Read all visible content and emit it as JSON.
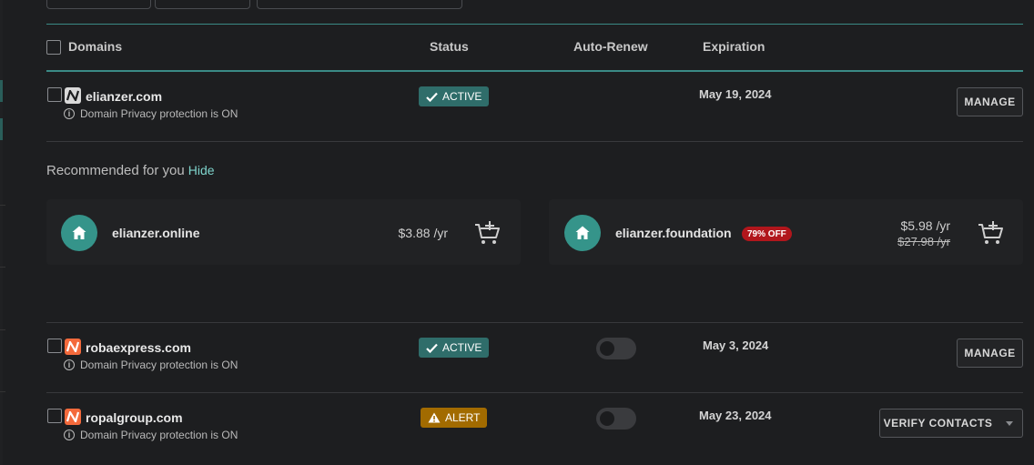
{
  "table": {
    "headers": {
      "domains": "Domains",
      "status": "Status",
      "auto_renew": "Auto-Renew",
      "expiration": "Expiration"
    }
  },
  "rows": [
    {
      "domain": "elianzer.com",
      "favicon": "namecheap-logo-gray",
      "privacy": "Domain Privacy protection is ON",
      "status": "ACTIVE",
      "status_icon": "check-icon",
      "auto_renew": null,
      "expiration": "May 19, 2024",
      "action": "MANAGE"
    },
    {
      "domain": "robaexpress.com",
      "favicon": "namecheap-logo-orange",
      "privacy": "Domain Privacy protection is ON",
      "status": "ACTIVE",
      "status_icon": "check-icon",
      "auto_renew": false,
      "expiration": "May 3, 2024",
      "action": "MANAGE"
    },
    {
      "domain": "ropalgroup.com",
      "favicon": "namecheap-logo-orange",
      "privacy": "Domain Privacy protection is ON",
      "status": "ALERT",
      "status_icon": "warning-icon",
      "auto_renew": false,
      "expiration": "May 23, 2024",
      "action": "VERIFY CONTACTS"
    }
  ],
  "recommended": {
    "title": "Recommended for you",
    "hide_label": "Hide",
    "items": [
      {
        "name": "elianzer.online",
        "price": "$3.88 /yr"
      },
      {
        "name": "elianzer.foundation",
        "badge": "79% OFF",
        "price": "$5.98 /yr",
        "old_price": "$27.98 /yr"
      }
    ]
  },
  "colors": {
    "accent": "#3a8a86",
    "active_badge": "#2f6d6a",
    "alert_badge": "#a26b00",
    "discount_badge": "#b1161c",
    "house_circle": "#35948a",
    "favicon_orange": "#f46a3c"
  }
}
